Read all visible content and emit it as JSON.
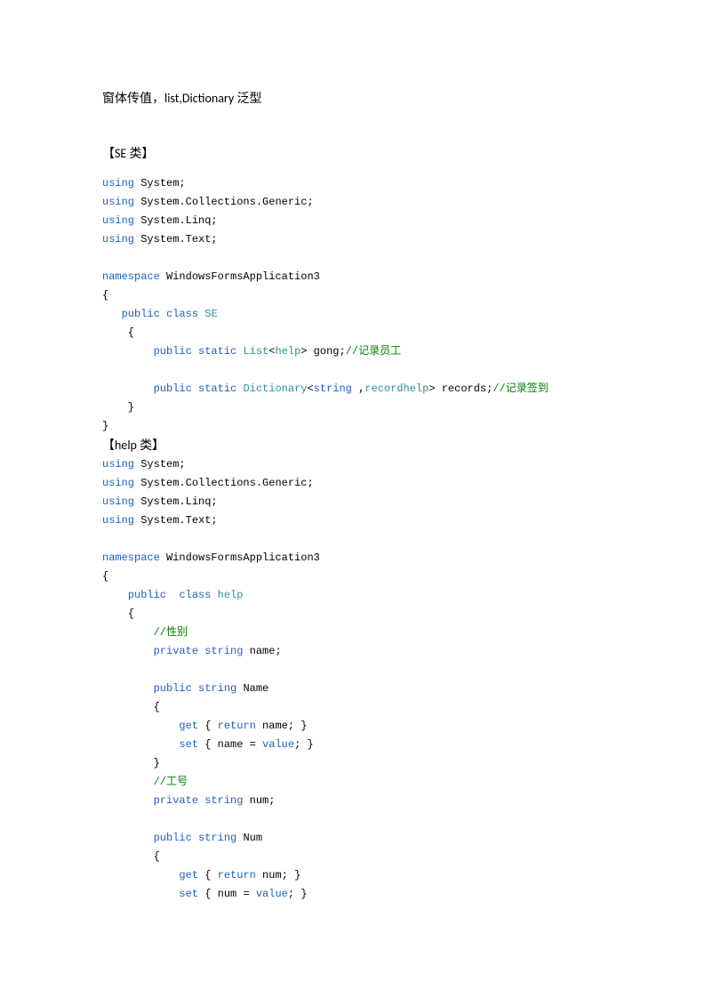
{
  "title_parts": {
    "t1": "窗体传值，",
    "t2": "list,Dictionary ",
    "t3": "泛型"
  },
  "section1": {
    "bracket_l": "【",
    "name": "SE ",
    "suffix": "类】"
  },
  "section2": {
    "bracket_l": "【",
    "name": "help ",
    "suffix": "类】"
  },
  "code1": {
    "l1_kw": "using",
    "l1_txt": " System;",
    "l2_kw": "using",
    "l2_txt": " System.Collections.Generic;",
    "l3_kw": "using",
    "l3_txt": " System.Linq;",
    "l4_kw": "using",
    "l4_txt": " System.Text;",
    "l5_kw": "namespace",
    "l5_txt": " WindowsFormsApplication3",
    "l6": "{",
    "l7_ind": "   ",
    "l7_kw1": "public",
    "l7_sp": " ",
    "l7_kw2": "class",
    "l7_sp2": " ",
    "l7_type": "SE",
    "l8": "    {",
    "l9_ind": "        ",
    "l9_kw1": "public",
    "l9_sp1": " ",
    "l9_kw2": "static",
    "l9_sp2": " ",
    "l9_type1": "List",
    "l9_lt": "<",
    "l9_type2": "help",
    "l9_gt": "> gong;",
    "l9_com": "//记录员工",
    "l10_ind": "        ",
    "l10_kw1": "public",
    "l10_sp1": " ",
    "l10_kw2": "static",
    "l10_sp2": " ",
    "l10_type1": "Dictionary",
    "l10_lt": "<",
    "l10_kw3": "string",
    "l10_cm": " ,",
    "l10_type2": "recordhelp",
    "l10_gt": "> records;",
    "l10_com": "//记录签到",
    "l11": "    }",
    "l12": "}"
  },
  "code2": {
    "l1_kw": "using",
    "l1_txt": " System;",
    "l2_kw": "using",
    "l2_txt": " System.Collections.Generic;",
    "l3_kw": "using",
    "l3_txt": " System.Linq;",
    "l4_kw": "using",
    "l4_txt": " System.Text;",
    "l5_kw": "namespace",
    "l5_txt": " WindowsFormsApplication3",
    "l6": "{",
    "l7_ind": "    ",
    "l7_kw1": "public",
    "l7_sp": "  ",
    "l7_kw2": "class",
    "l7_sp2": " ",
    "l7_type": "help",
    "l8": "    {",
    "l9_ind": "        ",
    "l9_com": "//性别",
    "l10_ind": "        ",
    "l10_kw1": "private",
    "l10_sp": " ",
    "l10_kw2": "string",
    "l10_txt": " name;",
    "l11_ind": "        ",
    "l11_kw1": "public",
    "l11_sp": " ",
    "l11_kw2": "string",
    "l11_txt": " Name",
    "l12": "        {",
    "l13_ind": "            ",
    "l13_kw1": "get",
    "l13_sp": " { ",
    "l13_kw2": "return",
    "l13_txt": " name; }",
    "l14_ind": "            ",
    "l14_kw1": "set",
    "l14_sp": " { name = ",
    "l14_kw2": "value",
    "l14_txt": "; }",
    "l15": "        }",
    "l16_ind": "        ",
    "l16_com": "//工号",
    "l17_ind": "        ",
    "l17_kw1": "private",
    "l17_sp": " ",
    "l17_kw2": "string",
    "l17_txt": " num;",
    "l18_ind": "        ",
    "l18_kw1": "public",
    "l18_sp": " ",
    "l18_kw2": "string",
    "l18_txt": " Num",
    "l19": "        {",
    "l20_ind": "            ",
    "l20_kw1": "get",
    "l20_sp": " { ",
    "l20_kw2": "return",
    "l20_txt": " num; }",
    "l21_ind": "            ",
    "l21_kw1": "set",
    "l21_sp": " { num = ",
    "l21_kw2": "value",
    "l21_txt": "; }"
  }
}
